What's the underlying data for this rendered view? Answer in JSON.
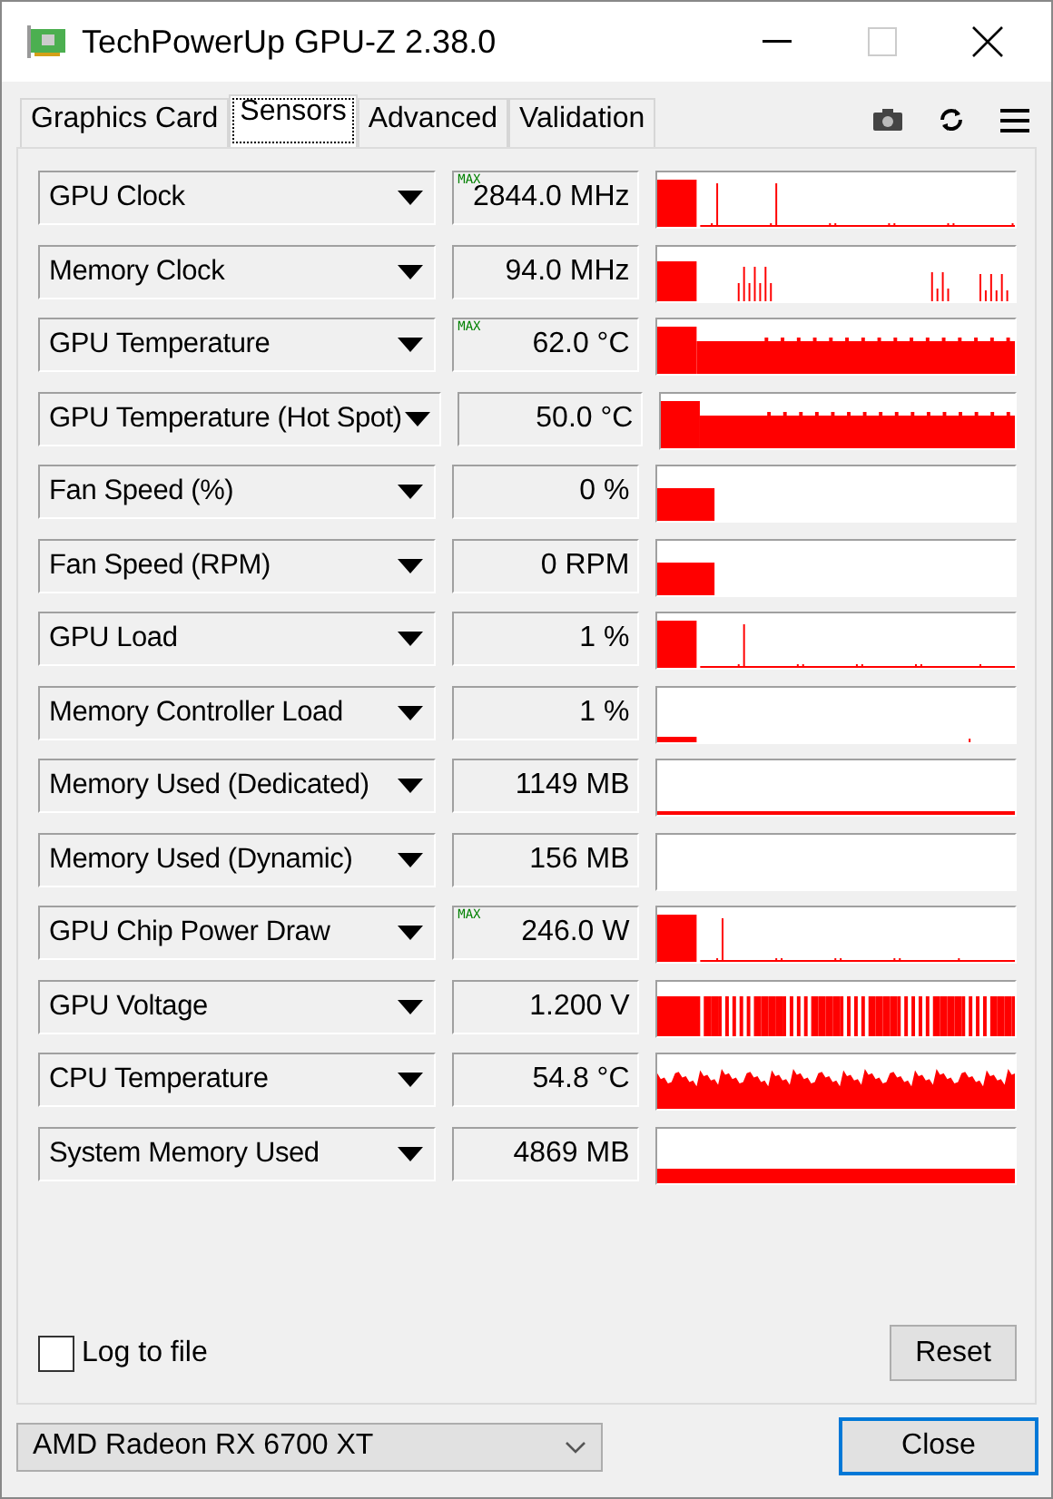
{
  "window": {
    "title": "TechPowerUp GPU-Z 2.38.0"
  },
  "tabs": [
    {
      "label": "Graphics Card",
      "selected": false
    },
    {
      "label": "Sensors",
      "selected": true
    },
    {
      "label": "Advanced",
      "selected": false
    },
    {
      "label": "Validation",
      "selected": false
    }
  ],
  "sensors": [
    {
      "name": "GPU Clock",
      "value": "2844.0 MHz",
      "badge": "MAX",
      "kind": "spikes"
    },
    {
      "name": "Memory Clock",
      "value": "94.0 MHz",
      "kind": "bursts"
    },
    {
      "name": "GPU Temperature",
      "value": "62.0 °C",
      "badge": "MAX",
      "kind": "plateau"
    },
    {
      "name": "GPU Temperature (Hot Spot)",
      "value": "50.0 °C",
      "kind": "plateau"
    },
    {
      "name": "Fan Speed (%)",
      "value": "0 %",
      "kind": "block"
    },
    {
      "name": "Fan Speed (RPM)",
      "value": "0 RPM",
      "kind": "block"
    },
    {
      "name": "GPU Load",
      "value": "1 %",
      "kind": "spikes"
    },
    {
      "name": "Memory Controller Load",
      "value": "1 %",
      "kind": "low"
    },
    {
      "name": "Memory Used (Dedicated)",
      "value": "1149 MB",
      "kind": "line"
    },
    {
      "name": "Memory Used (Dynamic)",
      "value": "156 MB",
      "kind": "empty"
    },
    {
      "name": "GPU Chip Power Draw",
      "value": "246.0 W",
      "badge": "MAX",
      "kind": "spikes"
    },
    {
      "name": "GPU Voltage",
      "value": "1.200 V",
      "kind": "stripes"
    },
    {
      "name": "CPU Temperature",
      "value": "54.8 °C",
      "kind": "wave"
    },
    {
      "name": "System Memory Used",
      "value": "4869 MB",
      "kind": "band"
    }
  ],
  "log_to_file": {
    "label": "Log to file",
    "checked": false
  },
  "reset_button": "Reset",
  "gpu_select": {
    "value": "AMD Radeon RX 6700 XT"
  },
  "close_button": "Close"
}
